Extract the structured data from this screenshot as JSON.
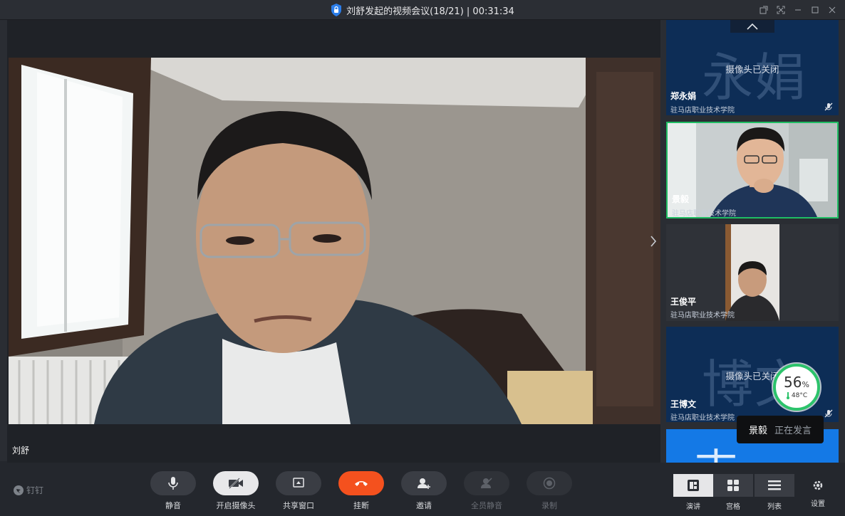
{
  "window": {
    "title": "刘舒发起的视频会议(18/21) | 00:31:34"
  },
  "main_video": {
    "participant_name": "刘舒"
  },
  "participants": [
    {
      "name": "郑永娟",
      "org": "驻马店职业技术学院",
      "avatar_text": "永娟",
      "camera_status": "摄像头已关闭",
      "mic_muted": true
    },
    {
      "name": "景毅",
      "org": "驻马店职业技术学院",
      "active": true
    },
    {
      "name": "王俊平",
      "org": "驻马店职业技术学院"
    },
    {
      "name": "王博文",
      "org": "驻马店职业技术学院",
      "avatar_text": "博文",
      "camera_status": "摄像头已关闭",
      "mic_muted": true
    }
  ],
  "partial_tile_text": "志",
  "system_monitor": {
    "cpu_percent": "56",
    "percent_sign": "%",
    "temperature": "48°C"
  },
  "speaking_indicator": {
    "name": "景毅",
    "status": "正在发言"
  },
  "toolbar": {
    "brand": "钉钉",
    "mute_label": "静音",
    "camera_label": "开启摄像头",
    "share_label": "共享窗口",
    "hangup_label": "挂断",
    "invite_label": "邀请",
    "mute_all_label": "全员静音",
    "record_label": "录制"
  },
  "view_modes": {
    "speaker_label": "演讲",
    "grid_label": "宫格",
    "list_label": "列表",
    "settings_label": "设置"
  },
  "colors": {
    "hangup": "#f4511e",
    "active_border": "#1fbd63",
    "tile_dark": "#0d2d56",
    "tile_bright": "#1479e6"
  }
}
